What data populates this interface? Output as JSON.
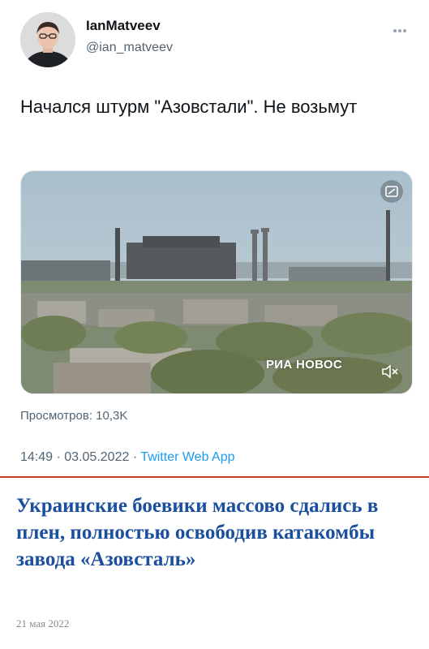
{
  "tweet": {
    "user": {
      "name": "IanMatveev",
      "handle": "@ian_matveev"
    },
    "more_icon": "more-dots-icon",
    "text": "Начался штурм \"Азовстали\". Не возьмут",
    "media": {
      "watermark": "РИА НОВОС",
      "icons": [
        "picture-in-picture-icon",
        "mute-icon"
      ]
    },
    "views": "Просмотров: 10,3K",
    "time": "14:49",
    "date": "03.05.2022",
    "separator": "·",
    "source": "Twitter Web App",
    "colors": {
      "link": "#1d9bf0",
      "secondary": "#536471"
    }
  },
  "article": {
    "headline": "Украинские боевики массово сдались в плен, полностью освободив катакомбы завода «Азовсталь»",
    "date": "21 мая 2022",
    "colors": {
      "headline": "#1b4f9e",
      "divider": "#c0392b"
    }
  }
}
